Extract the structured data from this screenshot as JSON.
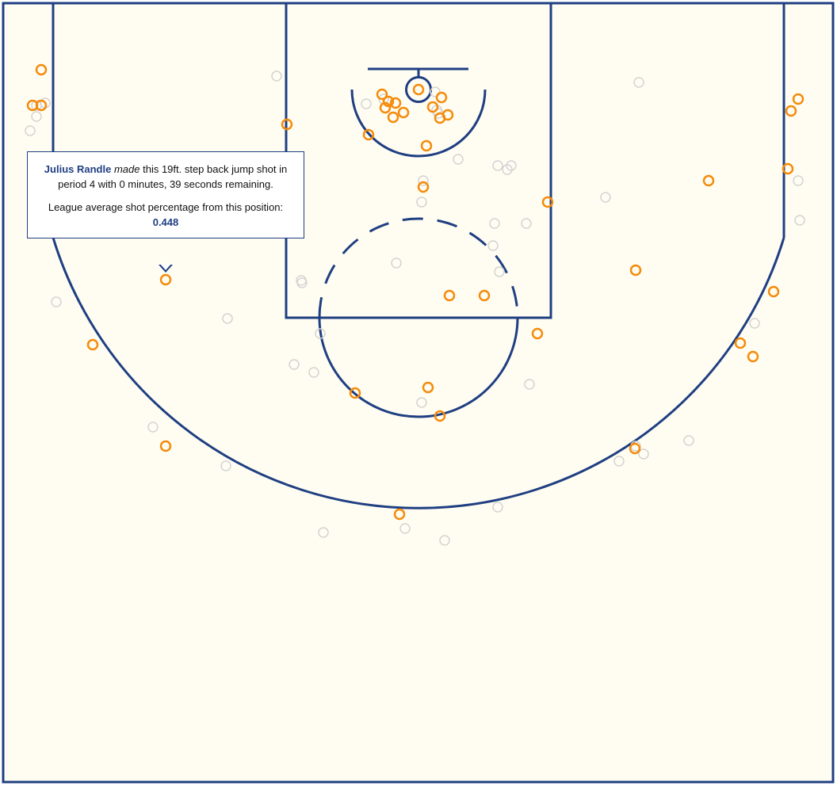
{
  "colors": {
    "court_background": "#fffdf2",
    "court_lines": "#1f3f82",
    "player_shot": "#f58b0b",
    "league_shot": "#d3d3d3"
  },
  "chart_data": {
    "type": "scatter",
    "title": "",
    "series": [
      {
        "key": "player",
        "points": [
          [
            52,
            88
          ],
          [
            41,
            133
          ],
          [
            52,
            133
          ],
          [
            362,
            157
          ],
          [
            465,
            170
          ],
          [
            482,
            119
          ],
          [
            490,
            128
          ],
          [
            499,
            130
          ],
          [
            486,
            136
          ],
          [
            496,
            148
          ],
          [
            509,
            142
          ],
          [
            528,
            113
          ],
          [
            557,
            123
          ],
          [
            546,
            135
          ],
          [
            565,
            145
          ],
          [
            555,
            149
          ],
          [
            538,
            184
          ],
          [
            534,
            236
          ],
          [
            691,
            255
          ],
          [
            894,
            228
          ],
          [
            994,
            213
          ],
          [
            1007,
            125
          ],
          [
            998,
            140
          ],
          [
            802,
            341
          ],
          [
            976,
            368
          ],
          [
            611,
            373
          ],
          [
            567,
            373
          ],
          [
            678,
            421
          ],
          [
            934,
            433
          ],
          [
            950,
            450
          ],
          [
            209,
            353
          ],
          [
            117,
            435
          ],
          [
            448,
            496
          ],
          [
            540,
            489
          ],
          [
            555,
            525
          ],
          [
            209,
            563
          ],
          [
            801,
            566
          ],
          [
            504,
            649
          ]
        ]
      },
      {
        "key": "league",
        "points": [
          [
            46,
            133
          ],
          [
            57,
            130
          ],
          [
            46,
            147
          ],
          [
            38,
            165
          ],
          [
            349,
            96
          ],
          [
            462,
            131
          ],
          [
            484,
            125
          ],
          [
            549,
            116
          ],
          [
            551,
            139
          ],
          [
            553,
            143
          ],
          [
            806,
            104
          ],
          [
            578,
            201
          ],
          [
            628,
            209
          ],
          [
            640,
            214
          ],
          [
            645,
            209
          ],
          [
            534,
            228
          ],
          [
            532,
            255
          ],
          [
            764,
            249
          ],
          [
            1007,
            228
          ],
          [
            1009,
            278
          ],
          [
            624,
            282
          ],
          [
            664,
            282
          ],
          [
            622,
            310
          ],
          [
            630,
            343
          ],
          [
            500,
            332
          ],
          [
            380,
            354
          ],
          [
            381,
            357
          ],
          [
            71,
            381
          ],
          [
            287,
            402
          ],
          [
            404,
            421
          ],
          [
            371,
            460
          ],
          [
            396,
            470
          ],
          [
            952,
            408
          ],
          [
            668,
            485
          ],
          [
            532,
            508
          ],
          [
            193,
            539
          ],
          [
            285,
            588
          ],
          [
            802,
            563
          ],
          [
            812,
            573
          ],
          [
            781,
            582
          ],
          [
            869,
            556
          ],
          [
            628,
            640
          ],
          [
            511,
            667
          ],
          [
            408,
            672
          ],
          [
            561,
            682
          ]
        ]
      }
    ]
  },
  "tooltip": {
    "player": "Julius Randle",
    "result": "made",
    "description": " this 19ft. step back jump shot in period 4 with 0 minutes, 39 seconds remaining.",
    "avg_label": "League average shot percentage from this position:",
    "avg_value": "0.448"
  }
}
